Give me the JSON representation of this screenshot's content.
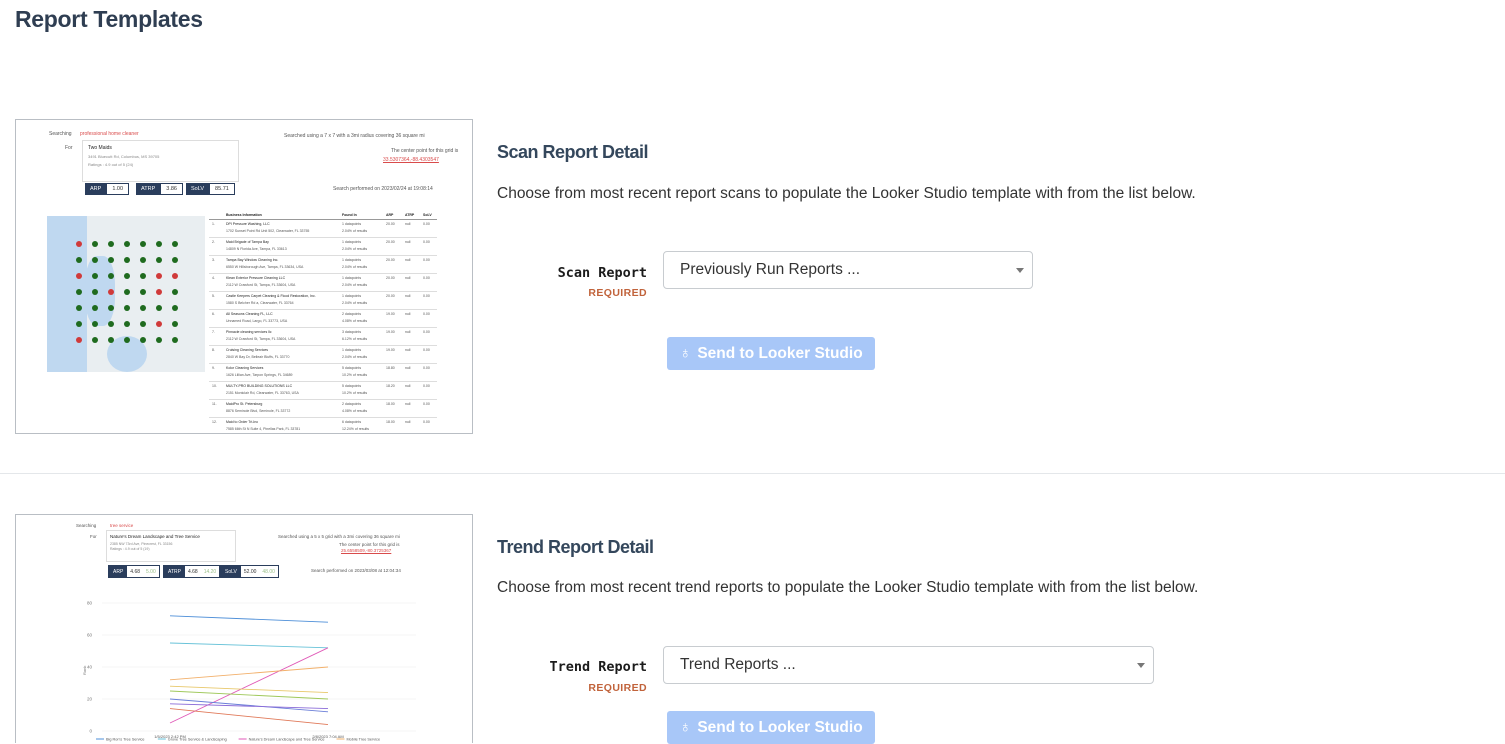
{
  "page": {
    "title": "Report Templates"
  },
  "scan_section": {
    "title": "Scan Report Detail",
    "description": "Choose from most recent report scans to populate the Looker Studio template with from the list below.",
    "field_label": "Scan Report",
    "required": "REQUIRED",
    "select_value": "Previously Run Reports ...",
    "button_label": "Send to Looker Studio",
    "button_icon": "looker-icon",
    "preview": {
      "searching_label": "Searching",
      "keyword": "professional home cleaner",
      "for_label": "For",
      "business": "Two Maids",
      "address": "3491 Bluecutt Rd, Columbus, MS 39705",
      "ratings": "Ratings : 4.9 out of 5 (24)",
      "grid_note": "Searched using a 7 x 7 with a 3mi radius covering 36 square mi",
      "center_note": "The center point for this grid is",
      "center_coords": "33.5307364,-88.4303547",
      "performed": "Search performed on 2023/02/24 at 19:08:14",
      "kpis": [
        {
          "label": "ARP",
          "value": "1.00"
        },
        {
          "label": "ATRP",
          "value": "3.86"
        },
        {
          "label": "SoLV",
          "value": "85.71"
        }
      ],
      "table_headers": [
        "Business Information",
        "Found In",
        "ARP",
        "ATRP",
        "SoLV"
      ],
      "rows": [
        {
          "n": "1.",
          "name": "DPI Pressure Washing, LLC",
          "addr": "1702 Sunset Point Rd Unit 502, Clearwater, FL 33755",
          "found": "1 datapoints",
          "pct": "2.04% of results",
          "arp": "20.00",
          "atrp": "null",
          "solv": "0.00"
        },
        {
          "n": "2.",
          "name": "Maid Brigade of Tampa Bay",
          "addr": "14809 N Florida Ave, Tampa, FL 33613",
          "found": "1 datapoints",
          "pct": "2.04% of results",
          "arp": "20.00",
          "atrp": "null",
          "solv": "0.00"
        },
        {
          "n": "3.",
          "name": "Tampa Bay Window Cleaning Inc.",
          "addr": "6550 W Hillsborough Ave, Tampa, FL 33634, USA",
          "found": "1 datapoints",
          "pct": "2.04% of results",
          "arp": "20.00",
          "atrp": "null",
          "solv": "0.00"
        },
        {
          "n": "4.",
          "name": "Klean Exterior Pressure Cleaning LLC",
          "addr": "2112 W Crawford St, Tampa, FL 33604, USA",
          "found": "1 datapoints",
          "pct": "2.04% of results",
          "arp": "20.00",
          "atrp": "null",
          "solv": "0.00"
        },
        {
          "n": "5.",
          "name": "Castle Keepers Carpet Cleaning & Flood Restoration, Inc.",
          "addr": "1580 S Belcher Rd a, Clearwater, FL 33764",
          "found": "1 datapoints",
          "pct": "2.04% of results",
          "arp": "20.00",
          "atrp": "null",
          "solv": "0.00"
        },
        {
          "n": "6.",
          "name": "All Seasons Cleaning FL, LLC",
          "addr": "Unnamed Road, Largo, FL 33773, USA",
          "found": "2 datapoints",
          "pct": "4.08% of results",
          "arp": "19.00",
          "atrp": "null",
          "solv": "0.00"
        },
        {
          "n": "7.",
          "name": "Pinnacle cleaning services llc",
          "addr": "2112 W Crawford St, Tampa, FL 33604, USA",
          "found": "3 datapoints",
          "pct": "6.12% of results",
          "arp": "19.00",
          "atrp": "null",
          "solv": "0.00"
        },
        {
          "n": "8.",
          "name": "Cruising Cleaning Services",
          "addr": "2840 W Bay Dr, Belleair Bluffs, FL 33770",
          "found": "1 datapoints",
          "pct": "2.04% of results",
          "arp": "19.00",
          "atrp": "null",
          "solv": "0.00"
        },
        {
          "n": "9.",
          "name": "Kolor Cleaning Services",
          "addr": "1626 Lillian Ave, Tarpon Springs, FL 34689",
          "found": "5 datapoints",
          "pct": "10.2% of results",
          "arp": "18.80",
          "atrp": "null",
          "solv": "0.00"
        },
        {
          "n": "10.",
          "name": "MULTY-PRO BUILDING SOLUTIONS LLC",
          "addr": "2151 Montclair Rd, Clearwater, FL 33763, USA",
          "found": "5 datapoints",
          "pct": "10.2% of results",
          "arp": "18.20",
          "atrp": "null",
          "solv": "0.00"
        },
        {
          "n": "11.",
          "name": "MaidPro St. Petersburg",
          "addr": "8876 Seminole Blvd, Seminole, FL 33772",
          "found": "2 datapoints",
          "pct": "4.08% of results",
          "arp": "18.00",
          "atrp": "null",
          "solv": "0.00"
        },
        {
          "n": "12.",
          "name": "Maid to Order Tri-Inc",
          "addr": "7585 66th St N Suite 4, Pinellas Park, FL 33781",
          "found": "6 datapoints",
          "pct": "12.24% of results",
          "arp": "18.00",
          "atrp": "null",
          "solv": "0.00"
        }
      ]
    }
  },
  "trend_section": {
    "title": "Trend Report Detail",
    "description": "Choose from most recent trend reports to populate the Looker Studio template with from the list below.",
    "field_label": "Trend Report",
    "required": "REQUIRED",
    "select_value": "Trend Reports ...",
    "button_label": "Send to Looker Studio",
    "button_icon": "looker-icon",
    "preview": {
      "searching_label": "Searching",
      "keyword": "tree service",
      "for_label": "For",
      "business": "Nature's Dream Landscape and Tree Service",
      "address": "2385 NW 73rd Ave, Pinecrest, FL 33156",
      "ratings": "Ratings : 4.9 out of 5 (19)",
      "grid_note": "Searched using a 5 x 5 grid with a 3mi covering 36 square mi",
      "center_note": "The center point for this grid is",
      "center_coords": "25.6558509,-80.3725367",
      "performed": "Search performed on 2023/03/08 at 12:04:34",
      "kpis": [
        {
          "label": "ARP",
          "value": "4.68",
          "delta": "5.00"
        },
        {
          "label": "ATRP",
          "value": "4.68",
          "delta": "14.20"
        },
        {
          "label": "SoLV",
          "value": "52.00",
          "delta": "48.00"
        }
      ],
      "chart_data": {
        "type": "line",
        "x": [
          "1/5/2023 2:42 PM",
          "2/8/2023 7:04 AM"
        ],
        "ylim": [
          0,
          80
        ],
        "yticks": [
          "0",
          "20",
          "40",
          "60",
          "80"
        ],
        "ylabel": "Rank",
        "series": [
          {
            "name": "Big Ron's Tree Service",
            "color": "#4e8fd8",
            "values": [
              72,
              68
            ]
          },
          {
            "name": "Grove Tree Service & Landscaping",
            "color": "#67c2d8",
            "values": [
              55,
              52
            ]
          },
          {
            "name": "Nature's Dream Landscape and Tree Service",
            "color": "#e05ab8",
            "values": [
              5,
              52
            ]
          },
          {
            "name": "Mobile Tree Service",
            "color": "#f2b06b",
            "values": [
              32,
              40
            ]
          },
          {
            "color": "#e8c86b",
            "values": [
              28,
              24
            ]
          },
          {
            "color": "#9fc85a",
            "values": [
              25,
              20
            ]
          },
          {
            "color": "#6b7fd8",
            "values": [
              20,
              12
            ]
          },
          {
            "color": "#e07a5a",
            "values": [
              14,
              4
            ]
          },
          {
            "color": "#8a6bd8",
            "values": [
              17,
              14
            ]
          }
        ]
      }
    }
  }
}
